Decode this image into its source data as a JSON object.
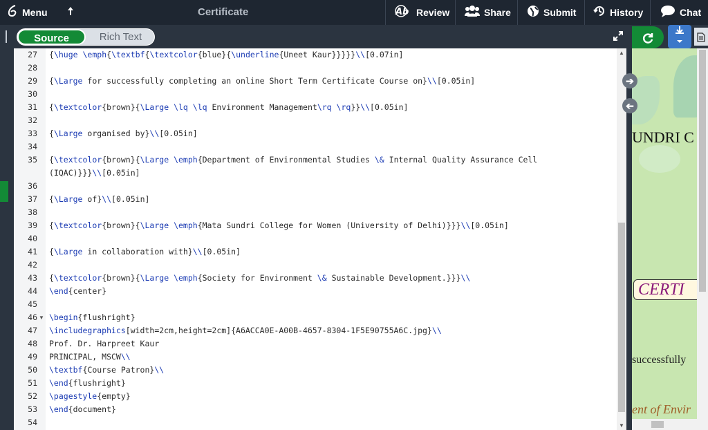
{
  "topbar": {
    "menu_label": "Menu",
    "title": "Certificate",
    "review_label": "Review",
    "share_label": "Share",
    "submit_label": "Submit",
    "history_label": "History",
    "chat_label": "Chat"
  },
  "editor_mode": {
    "source_label": "Source",
    "rich_text_label": "Rich Text"
  },
  "code_lines": [
    {
      "num": "27",
      "text": "{\\huge \\emph{\\textbf{\\textcolor{blue}{\\underline{Uneet Kaur}}}}}\\\\[0.07in]"
    },
    {
      "num": "28",
      "text": ""
    },
    {
      "num": "29",
      "text": "{\\Large for successfully completing an online Short Term Certificate Course on}\\\\[0.05in]"
    },
    {
      "num": "30",
      "text": ""
    },
    {
      "num": "31",
      "text": "{\\textcolor{brown}{\\Large \\lq \\lq Environment Management\\rq \\rq}}\\\\[0.05in]"
    },
    {
      "num": "32",
      "text": ""
    },
    {
      "num": "33",
      "text": "{\\Large organised by}\\\\[0.05in]"
    },
    {
      "num": "34",
      "text": ""
    },
    {
      "num": "35",
      "text": "{\\textcolor{brown}{\\Large \\emph{Department of Environmental Studies \\& Internal Quality Assurance Cell"
    },
    {
      "num": "",
      "text": "(IQAC)}}}\\\\[0.05in]"
    },
    {
      "num": "36",
      "text": ""
    },
    {
      "num": "37",
      "text": "{\\Large of}\\\\[0.05in]"
    },
    {
      "num": "38",
      "text": ""
    },
    {
      "num": "39",
      "text": "{\\textcolor{brown}{\\Large \\emph{Mata Sundri College for Women (University of Delhi)}}}\\\\[0.05in]"
    },
    {
      "num": "40",
      "text": ""
    },
    {
      "num": "41",
      "text": "{\\Large in collaboration with}\\\\[0.05in]"
    },
    {
      "num": "42",
      "text": ""
    },
    {
      "num": "43",
      "text": "{\\textcolor{brown}{\\Large \\emph{Society for Environment \\& Sustainable Development.}}}\\\\"
    },
    {
      "num": "44",
      "text": "\\end{center}"
    },
    {
      "num": "45",
      "text": ""
    },
    {
      "num": "46",
      "text": "\\begin{flushright}"
    },
    {
      "num": "47",
      "text": "\\includegraphics[width=2cm,height=2cm]{A6ACCA0E-A00B-4657-8304-1F5E90755A6C.jpg}\\\\"
    },
    {
      "num": "48",
      "text": "Prof. Dr. Harpreet Kaur"
    },
    {
      "num": "49",
      "text": "PRINCIPAL, MSCW\\\\"
    },
    {
      "num": "50",
      "text": "\\textbf{Course Patron}\\\\"
    },
    {
      "num": "51",
      "text": "\\end{flushright}"
    },
    {
      "num": "52",
      "text": "\\pagestyle{empty}"
    },
    {
      "num": "53",
      "text": "\\end{document}"
    },
    {
      "num": "54",
      "text": ""
    }
  ],
  "pdf_preview": {
    "line1": "UNDRI C",
    "cert": "CERTI",
    "line2": "successfully",
    "line3": "ent of Envir"
  },
  "icons": {
    "menu": "overleaf-leaf-icon",
    "upload": "upload-arrow-icon",
    "review": "review-ab-icon",
    "share": "people-icon",
    "submit": "globe-icon",
    "history": "history-clock-icon",
    "chat": "speech-bubble-icon",
    "expand": "expand-arrows-icon",
    "recompile": "refresh-icon",
    "download": "download-icon",
    "document": "document-icon"
  },
  "colors": {
    "accent_green": "#138a36",
    "toolbar_bg": "#1e2631",
    "download_blue": "#3c78c9"
  }
}
